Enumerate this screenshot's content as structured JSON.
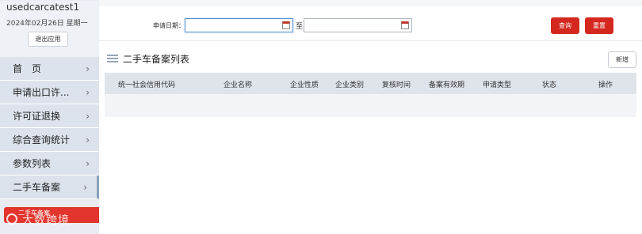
{
  "sidebar": {
    "username": "usedcarcatest1",
    "date": "2024年02月26日 星期一",
    "logout_label": "退出应用",
    "items": [
      {
        "label": "首　页"
      },
      {
        "label": "申请出口许..."
      },
      {
        "label": "许可证退换"
      },
      {
        "label": "综合查询统计"
      },
      {
        "label": "参数列表"
      },
      {
        "label": "二手车备案"
      }
    ],
    "active_submenu": "二手车备案",
    "watermark": "大数跨境"
  },
  "filter": {
    "date_label": "申请日期：",
    "to_label": "至",
    "query_label": "查询",
    "reset_label": "重置"
  },
  "list": {
    "title": "二手车备案列表",
    "add_label": "新增",
    "columns": [
      "统一社会信用代码",
      "企业名称",
      "企业性质",
      "企业类别",
      "复核时间",
      "备案有效期",
      "申请类型",
      "状态",
      "操作"
    ]
  },
  "colors": {
    "accent_red": "#d4281f",
    "sidebar_bg": "#dde3ec",
    "table_head_bg": "#dfe4eb"
  }
}
